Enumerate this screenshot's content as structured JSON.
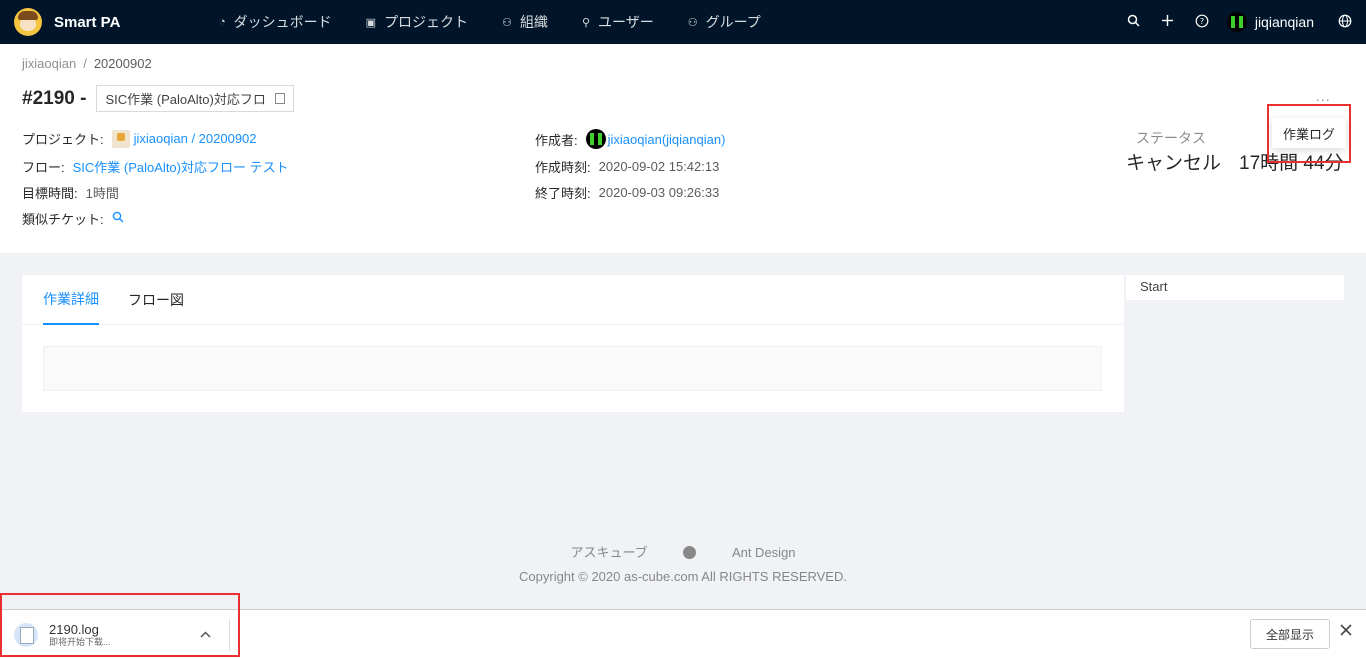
{
  "app": {
    "title": "Smart PA"
  },
  "nav": {
    "items": [
      {
        "label": "ダッシュボード"
      },
      {
        "label": "プロジェクト"
      },
      {
        "label": "組織"
      },
      {
        "label": "ユーザー"
      },
      {
        "label": "グループ"
      }
    ],
    "user": "jiqianqian"
  },
  "breadcrumb": [
    "jixiaoqian",
    "/",
    "20200902"
  ],
  "ticket": {
    "number": "#2190 -",
    "title": "SIC作業 (PaloAlto)対応フロ"
  },
  "info": {
    "project_label": "プロジェクト:",
    "project_value": "jixiaoqian / 20200902",
    "flow_label": "フロー:",
    "flow_value": "SIC作業 (PaloAlto)対応フロー テスト",
    "target_label": "目標時間:",
    "target_value": "1時間",
    "similar_label": "類似チケット:",
    "author_label": "作成者:",
    "author_value": "jixiaoqian(jiqianqian)",
    "created_label": "作成時刻:",
    "created_value": "2020-09-02 15:42:13",
    "ended_label": "終了時刻:",
    "ended_value": "2020-09-03 09:26:33"
  },
  "status": {
    "label": "ステータス",
    "value": "キャンセル",
    "duration": "17時間 44分"
  },
  "more": "...",
  "dropdown": {
    "item": "作業ログ"
  },
  "tabs": [
    {
      "label": "作業詳細",
      "active": true
    },
    {
      "label": "フロー図",
      "active": false
    }
  ],
  "side": {
    "start": "Start"
  },
  "footer": {
    "link1": "アスキューブ",
    "link3": "Ant Design",
    "copyright": "Copyright © 2020 as-cube.com All RIGHTS RESERVED."
  },
  "download": {
    "file": "2190.log",
    "status": "即将开始下载...",
    "show_all": "全部显示"
  }
}
